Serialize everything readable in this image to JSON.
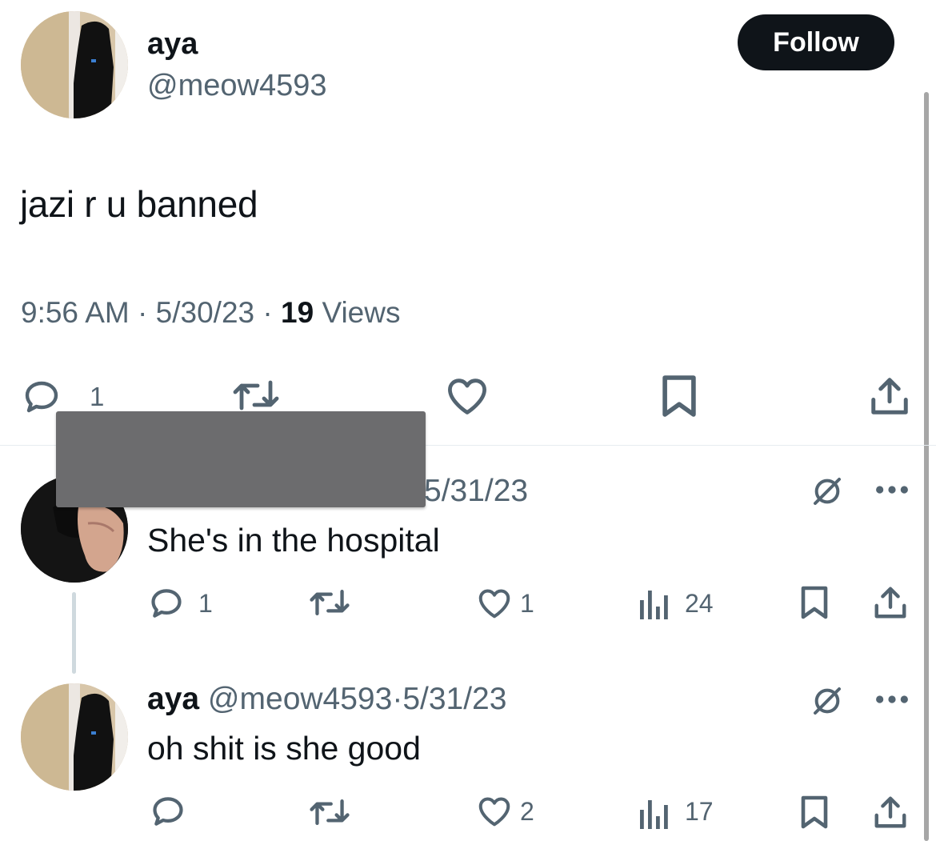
{
  "main_tweet": {
    "author_name": "aya",
    "author_handle": "@meow4593",
    "follow_label": "Follow",
    "text": "jazi r u banned",
    "time": "9:56 AM",
    "date": "5/30/23",
    "views_count": "19",
    "views_label": "Views",
    "separator": "·",
    "reply_count": "1",
    "icons": [
      "reply-icon",
      "retweet-icon",
      "like-icon",
      "bookmark-icon",
      "share-icon"
    ]
  },
  "replies": [
    {
      "date": "5/31/23",
      "text": "She's in the hospital",
      "reply_count": "1",
      "like_count": "1",
      "views_count": "24"
    },
    {
      "author_name": "aya",
      "author_handle": "@meow4593",
      "separator": "·",
      "date": "5/31/23",
      "text": "oh shit is she good",
      "like_count": "2",
      "views_count": "17"
    }
  ],
  "colors": {
    "text": "#0f1419",
    "secondary": "#536471",
    "follow_bg": "#0f1419",
    "redaction": "#6c6c6e",
    "divider": "#e6ecf0"
  }
}
